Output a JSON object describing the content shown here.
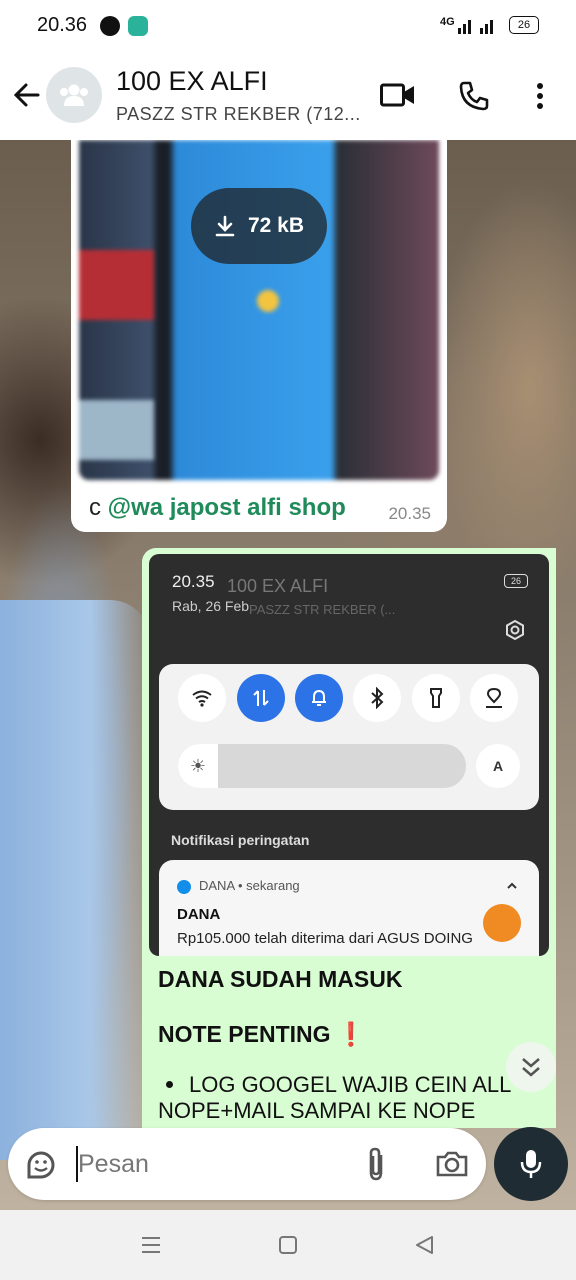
{
  "status_bar": {
    "time": "20.36",
    "network": "4G",
    "battery": "26"
  },
  "header": {
    "title": "100 EX ALFI",
    "subtitle": "PASZZ STR REKBER (712..."
  },
  "incoming": {
    "download_size": "72 kB",
    "caption_prefix": "c ",
    "caption_mention": "@wa japost alfi shop",
    "time": "20.35"
  },
  "outgoing": {
    "screenshot": {
      "time": "20.35",
      "date": "Rab, 26 Feb",
      "title": "100 EX ALFI",
      "subtitle": "PASZZ STR REKBER (...",
      "battery": "26",
      "brightness_auto": "A",
      "notif_heading": "Notifikasi peringatan",
      "notif_app": "DANA • sekarang",
      "notif_title": "DANA",
      "notif_message": "Rp105.000 telah diterima dari AGUS DOING"
    },
    "line1": "DANA SUDAH MASUK",
    "line2": "NOTE PENTING",
    "line2_icon": "❗",
    "bullet": "LOG GOOGEL WAJIB CEIN ALL NOPE+MAIL SAMPAI KE NOPE"
  },
  "composer": {
    "placeholder": "Pesan"
  },
  "colors": {
    "outgoing_bubble": "#d9fdd3",
    "mention": "#1f8a5a",
    "mic": "#1f2c34"
  }
}
